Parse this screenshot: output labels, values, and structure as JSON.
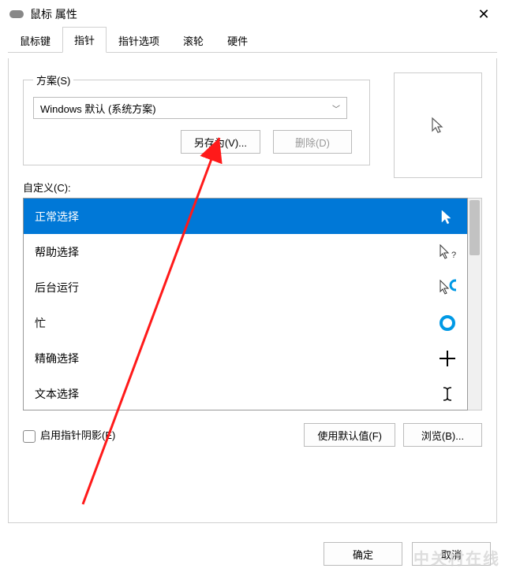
{
  "window": {
    "title": "鼠标 属性"
  },
  "tabs": {
    "t0": "鼠标键",
    "t1": "指针",
    "t2": "指针选项",
    "t3": "滚轮",
    "t4": "硬件"
  },
  "scheme": {
    "legend": "方案(S)",
    "selected": "Windows 默认 (系统方案)",
    "saveas": "另存为(V)...",
    "delete": "删除(D)"
  },
  "custom": {
    "label": "自定义(C):",
    "items": [
      "正常选择",
      "帮助选择",
      "后台运行",
      "忙",
      "精确选择",
      "文本选择"
    ]
  },
  "options": {
    "shadow": "启用指针阴影(E)",
    "usedefault": "使用默认值(F)",
    "browse": "浏览(B)..."
  },
  "actions": {
    "ok": "确定",
    "cancel": "取消"
  },
  "watermark": "中关村在线"
}
